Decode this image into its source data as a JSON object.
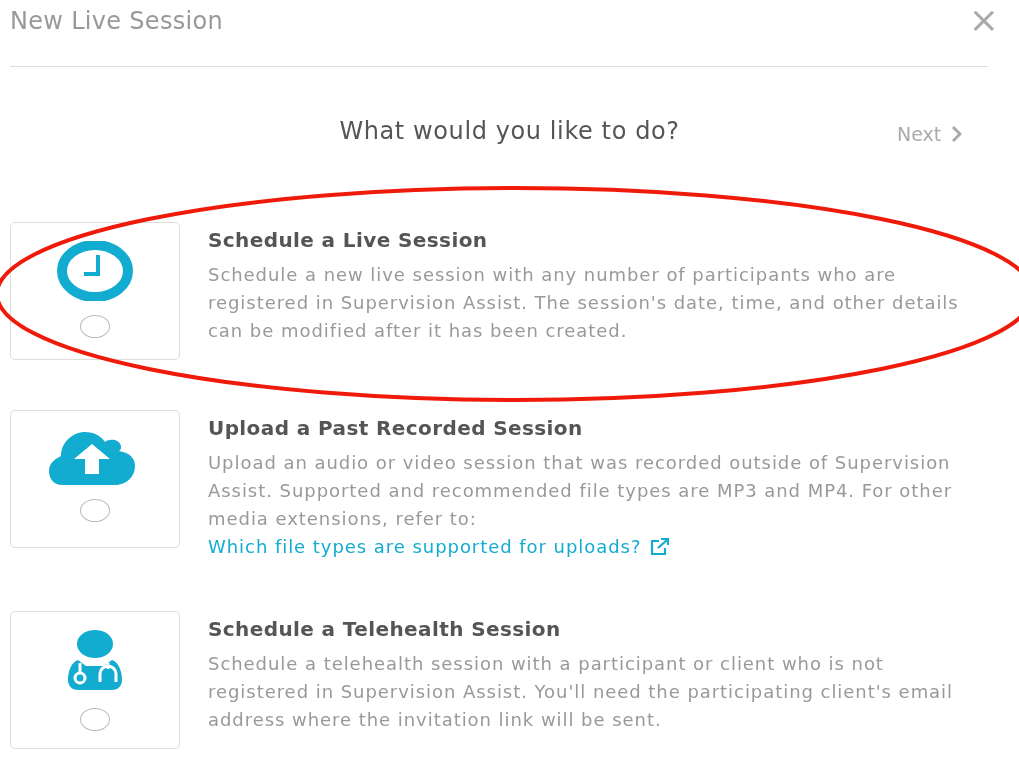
{
  "dialog": {
    "title": "New Live Session",
    "close": "×"
  },
  "question": "What would you like to do?",
  "next": {
    "label": "Next",
    "disabled": true
  },
  "options": [
    {
      "kind": "clock",
      "title": "Schedule a Live Session",
      "description": "Schedule a new live session with any number of participants who are registered in Supervision Assist. The session's date, time, and other details can be modified after it has been created.",
      "selected": false,
      "highlighted": true
    },
    {
      "kind": "upload",
      "title": "Upload a Past Recorded Session",
      "description": "Upload an audio or video session that was recorded outside of Supervision Assist. Supported and recommended file types are MP3 and MP4. For other media extensions, refer to:",
      "link": "Which file types are supported for uploads?",
      "selected": false,
      "highlighted": false
    },
    {
      "kind": "doctor",
      "title": "Schedule a Telehealth Session",
      "description": "Schedule a telehealth session with a participant or client who is not registered in Supervision Assist. You'll need the participating client's email address where the invitation link will be sent.",
      "selected": false,
      "highlighted": false
    }
  ]
}
